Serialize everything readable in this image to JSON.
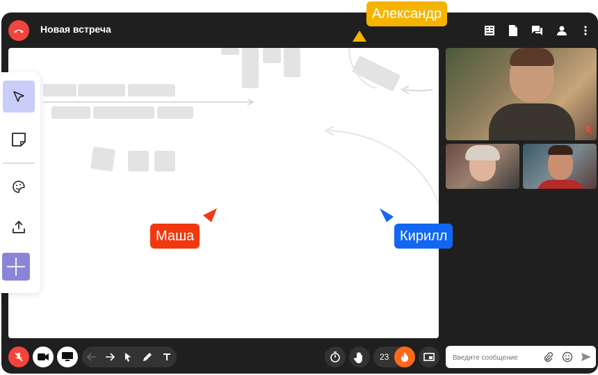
{
  "header": {
    "title": "Новая встреча"
  },
  "cursors": [
    {
      "name": "Александр",
      "color": "#f6b400"
    },
    {
      "name": "Маша",
      "color": "#f2380f"
    },
    {
      "name": "Кирилл",
      "color": "#1167f2"
    }
  ],
  "toolbar": {
    "participants_count": "23"
  },
  "chat": {
    "placeholder": "Введите сообщение"
  },
  "colors": {
    "accent": "#f2453d",
    "panel": "#1f1f1f",
    "tool_active": "#c9cdfa",
    "add_button": "#8b85d8",
    "fire": "#ff6a1a"
  },
  "icons": [
    "phone-hangup-icon",
    "notes-icon",
    "document-icon",
    "chat-icon",
    "person-icon",
    "more-icon",
    "cursor-icon",
    "sticky-note-icon",
    "sticker-icon",
    "upload-icon",
    "plus-icon",
    "mic-off-icon",
    "camera-icon",
    "screen-share-icon",
    "arrow-left-icon",
    "arrow-right-icon",
    "pointer-icon",
    "pen-icon",
    "text-icon",
    "timer-icon",
    "hand-icon",
    "fire-icon",
    "picture-in-picture-icon",
    "attach-icon",
    "emoji-icon",
    "send-icon"
  ]
}
